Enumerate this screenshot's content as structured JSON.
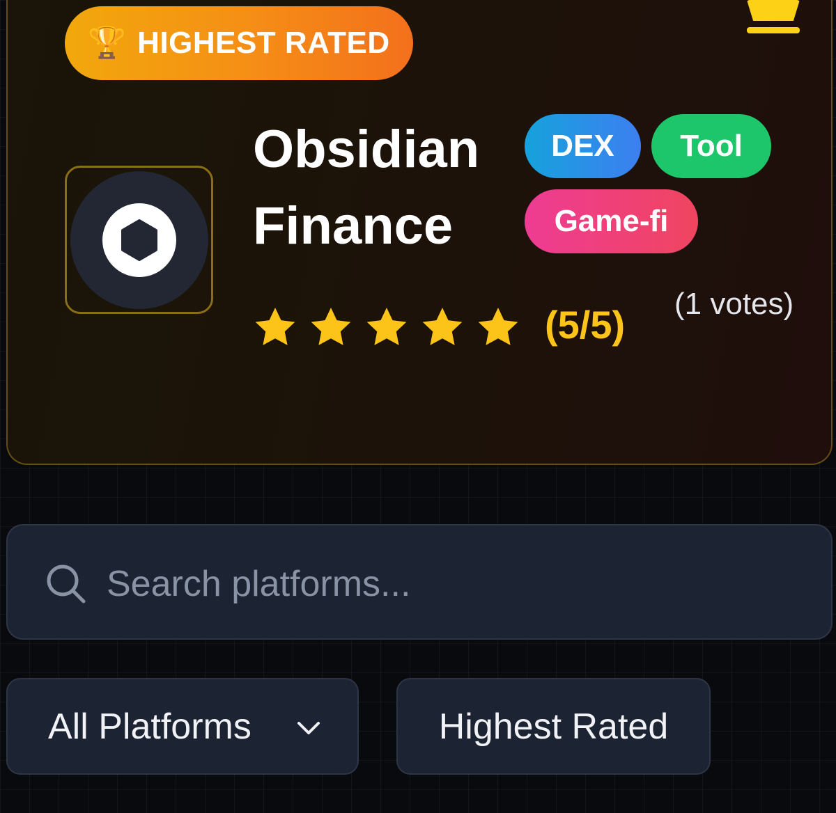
{
  "featured": {
    "badge_icon": "🏆",
    "badge_label": "HIGHEST RATED",
    "name": "Obsidian Finance",
    "tags": [
      "DEX",
      "Tool",
      "Game-fi"
    ],
    "rating_stars": 5,
    "rating_max": 5,
    "rating_text": "(5/5)",
    "votes_text": "(1 votes)",
    "logo_icon": "hexagon-logo-icon"
  },
  "header": {
    "menu_icon": "menu-icon",
    "accent_color": "#fcd116"
  },
  "search": {
    "placeholder": "Search platforms...",
    "value": ""
  },
  "filters": {
    "platform_select": "All Platforms",
    "sort_button": "Highest Rated"
  },
  "colors": {
    "badge_gradient": [
      "#f2a80c",
      "#f4701c"
    ],
    "dex": "#16a2dc",
    "tool": "#1ec66b",
    "gamefi": "#ee3c93",
    "star": "#fcc419"
  }
}
